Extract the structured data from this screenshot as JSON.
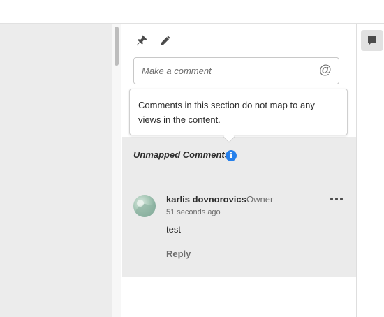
{
  "composer": {
    "placeholder": "Make a comment",
    "mention_symbol": "@"
  },
  "tooltip": {
    "text": "Comments in this section do not map to any views in the content."
  },
  "section": {
    "title": "Unmapped Comments",
    "info_glyph": "i"
  },
  "comment": {
    "author": "karlis dovnorovics",
    "role": "Owner",
    "time": "51 seconds ago",
    "body": "test",
    "reply_label": "Reply"
  },
  "icons": {
    "pin": "pin-icon",
    "edit": "pencil-icon",
    "more": "more-options-icon",
    "info": "info-icon",
    "comments": "comment-icon"
  },
  "colors": {
    "accent": "#2680eb",
    "section_bg": "#ebebeb",
    "left_pane": "#ececec"
  }
}
